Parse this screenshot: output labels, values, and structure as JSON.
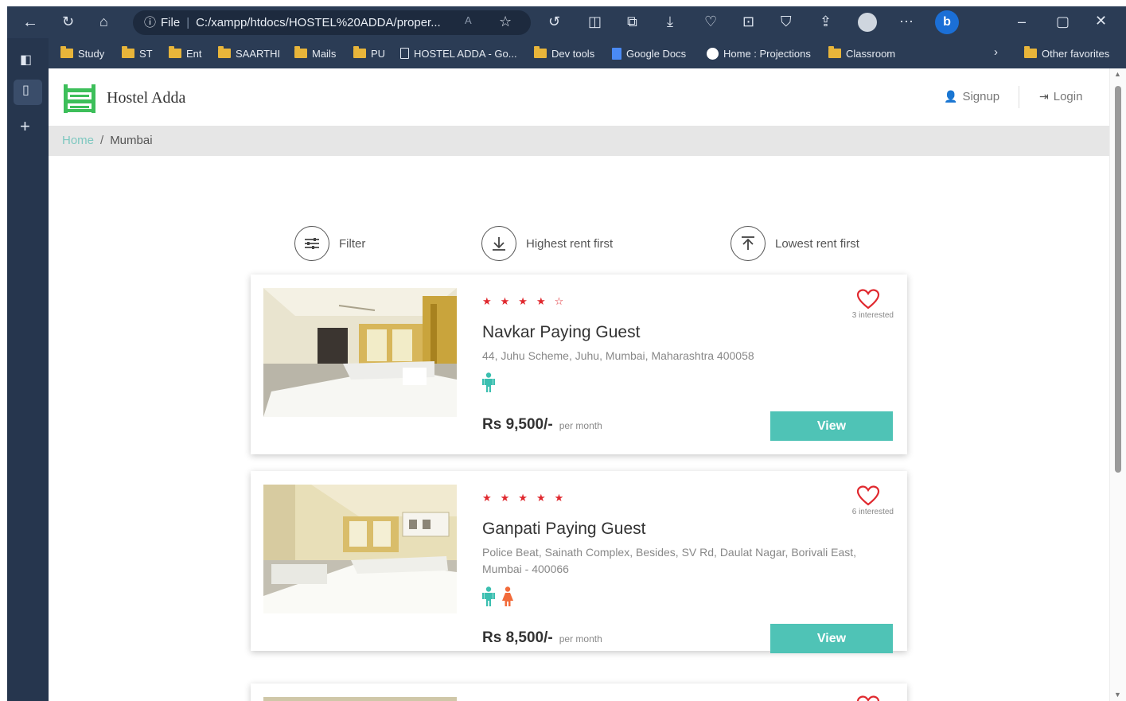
{
  "browser": {
    "address_prefix": "File",
    "url": "C:/xampp/htdocs/HOSTEL%20ADDA/proper...",
    "favorites": [
      {
        "label": "Study",
        "kind": "folder"
      },
      {
        "label": "ST",
        "kind": "folder"
      },
      {
        "label": "Ent",
        "kind": "folder"
      },
      {
        "label": "SAARTHI",
        "kind": "folder"
      },
      {
        "label": "Mails",
        "kind": "folder"
      },
      {
        "label": "PU",
        "kind": "folder"
      },
      {
        "label": "HOSTEL ADDA - Go...",
        "kind": "page"
      },
      {
        "label": "Dev tools",
        "kind": "folder"
      },
      {
        "label": "Google Docs",
        "kind": "docs"
      },
      {
        "label": "Home : Projections",
        "kind": "site"
      },
      {
        "label": "Classroom",
        "kind": "folder"
      }
    ],
    "other_favorites": "Other favorites"
  },
  "site": {
    "brand": "Hostel Adda",
    "signup": "Signup",
    "login": "Login",
    "breadcrumb_home": "Home",
    "breadcrumb_sep": "/",
    "breadcrumb_current": "Mumbai",
    "filter_label": "Filter",
    "highest_label": "Highest rent first",
    "lowest_label": "Lowest rent first",
    "view_label": "View",
    "per_month": "per month"
  },
  "listings": [
    {
      "name": "Navkar Paying Guest",
      "address": "44, Juhu Scheme, Juhu, Mumbai, Maharashtra 400058",
      "rating": 4.5,
      "interested": "3 interested",
      "gender": [
        "male"
      ],
      "price": "Rs 9,500/-"
    },
    {
      "name": "Ganpati Paying Guest",
      "address": "Police Beat, Sainath Complex, Besides, SV Rd, Daulat Nagar, Borivali East, Mumbai - 400066",
      "rating": 5,
      "interested": "6 interested",
      "gender": [
        "male",
        "female"
      ],
      "price": "Rs 8,500/-"
    }
  ],
  "colors": {
    "accent": "#4fc3b6",
    "star": "#e0282e",
    "male": "#3bbfb0",
    "female": "#f26b3a",
    "logo": "#3dbf5a"
  }
}
